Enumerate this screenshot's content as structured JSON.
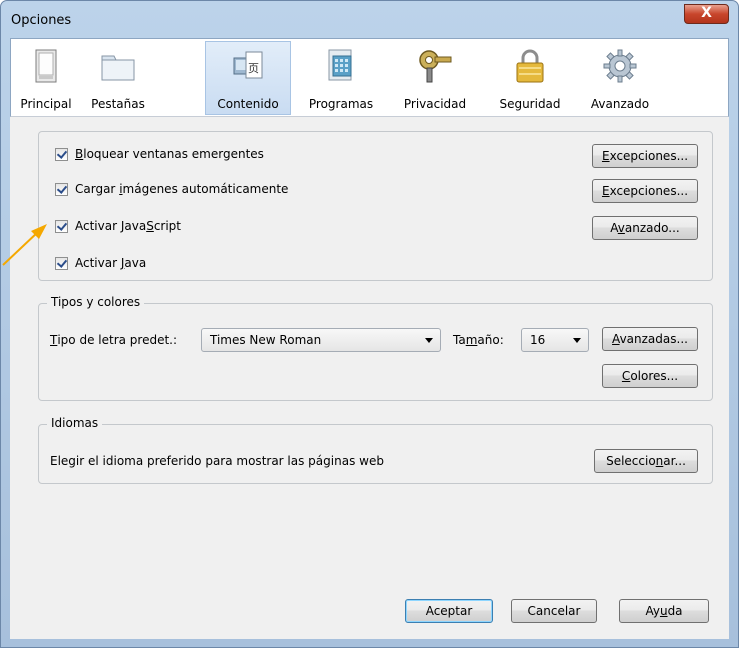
{
  "window": {
    "title": "Opciones",
    "close_glyph": "X"
  },
  "toolbar": {
    "tabs": [
      {
        "label": "Principal",
        "icon": "window-icon"
      },
      {
        "label": "Pestañas",
        "icon": "tabs-icon"
      },
      {
        "label": "Contenido",
        "icon": "content-icon",
        "selected": true
      },
      {
        "label": "Programas",
        "icon": "applications-icon"
      },
      {
        "label": "Privacidad",
        "icon": "key-icon"
      },
      {
        "label": "Seguridad",
        "icon": "lock-icon"
      },
      {
        "label": "Avanzado",
        "icon": "gear-icon"
      }
    ]
  },
  "content": {
    "checks": [
      {
        "pre": "",
        "u": "B",
        "post": "loquear ventanas emergentes",
        "checked": true,
        "button": {
          "pre": "",
          "u": "E",
          "post": "xcepciones..."
        }
      },
      {
        "pre": "Cargar ",
        "u": "i",
        "post": "mágenes automáticamente",
        "checked": true,
        "button": {
          "pre": "",
          "u": "E",
          "post": "xcepciones..."
        }
      },
      {
        "pre": "Activar Java",
        "u": "S",
        "post": "cript",
        "checked": true,
        "button": {
          "pre": "A",
          "u": "v",
          "post": "anzado..."
        }
      },
      {
        "pre": "Activar ",
        "u": "J",
        "post": "ava",
        "checked": true
      }
    ],
    "fonts": {
      "legend": "Tipos y colores",
      "label_pre": "",
      "label_u": "T",
      "label_post": "ipo de letra predet.:",
      "font_value": "Times New Roman",
      "size_pre": "Ta",
      "size_u": "m",
      "size_post": "año:",
      "size_value": "16",
      "advanced": {
        "pre": "",
        "u": "A",
        "post": "vanzadas..."
      },
      "colors": {
        "pre": "",
        "u": "C",
        "post": "olores..."
      }
    },
    "languages": {
      "legend": "Idiomas",
      "text": "Elegir el idioma preferido para mostrar las páginas web",
      "button": {
        "pre": "Seleccio",
        "u": "n",
        "post": "ar..."
      }
    }
  },
  "footer": {
    "ok": "Aceptar",
    "cancel": "Cancelar",
    "help": {
      "pre": "Ay",
      "u": "u",
      "post": "da"
    }
  },
  "colors": {
    "annotation_arrow": "#f5a800",
    "selected_tab": "#c9dcf2"
  }
}
